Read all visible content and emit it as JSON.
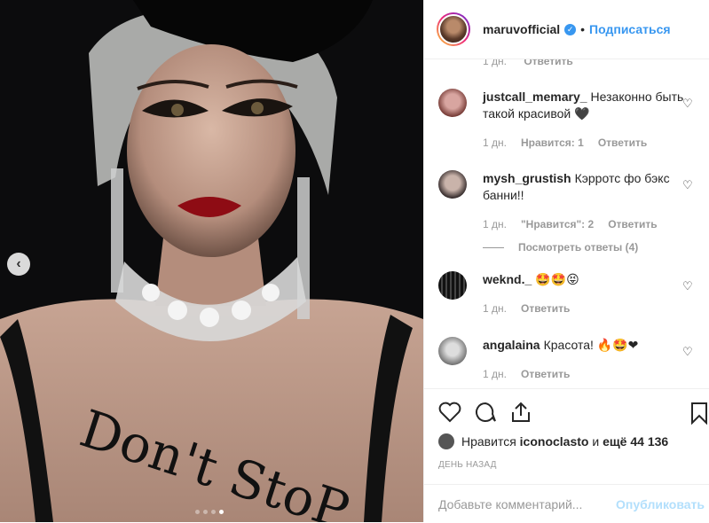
{
  "post": {
    "username": "maruvofficial",
    "follow_label": "Подписаться",
    "separator": "•",
    "carousel": {
      "total": 4,
      "active": 4
    },
    "chest_text": "Don't StoP"
  },
  "cut_comment": {
    "time": "1 дн.",
    "reply": "Ответить"
  },
  "comments": [
    {
      "user": "justcall_memary_",
      "text": "Незаконно быть такой красивой 🖤",
      "time": "1 дн.",
      "likes": "Нравится: 1",
      "reply": "Ответить"
    },
    {
      "user": "mysh_grustish",
      "text": "Кэрротс фо бэкс банни!!",
      "time": "1 дн.",
      "likes": "\"Нравится\": 2",
      "reply": "Ответить",
      "view_replies": "Посмотреть ответы (4)"
    },
    {
      "user": "weknd._",
      "text": "🤩🤩😝",
      "time": "1 дн.",
      "reply": "Ответить"
    },
    {
      "user": "angalaina",
      "text": "Красота! 🔥🤩❤",
      "time": "1 дн.",
      "reply": "Ответить"
    }
  ],
  "likes_line": {
    "prefix": "Нравится",
    "user": "iconoclasto",
    "middle": "и",
    "rest": "ещё 44 136"
  },
  "time_ago": "ДЕНЬ НАЗАД",
  "add_comment": {
    "placeholder": "Добавьте комментарий...",
    "publish_label": "Опубликовать"
  },
  "colors": {
    "accent": "#3897f0",
    "publish_disabled": "#b2dffc",
    "muted": "#999999"
  }
}
